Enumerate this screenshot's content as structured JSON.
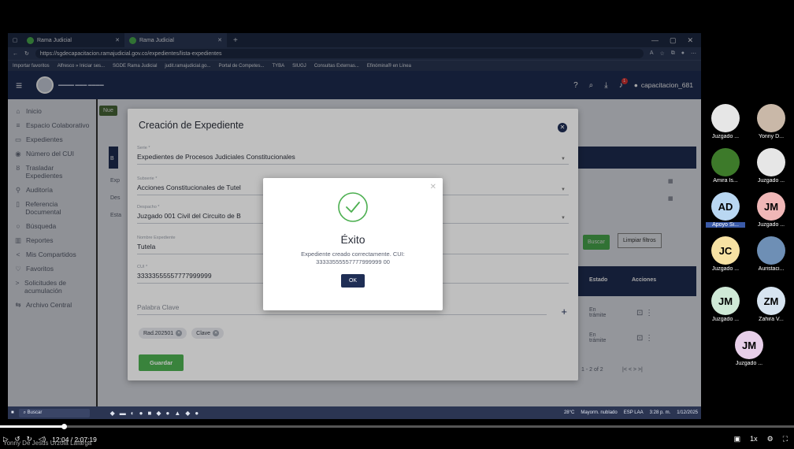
{
  "browser": {
    "tabs": [
      {
        "label": "Rama Judicial"
      },
      {
        "label": "Rama Judicial"
      }
    ],
    "url": "https://sgdecapacitacion.ramajudicial.gov.co/expedientes/lista-expedientes",
    "bookmarks": [
      "Importar favoritos",
      "Alfresco » Iniciar ses...",
      "SGDE Rama Judicial",
      "judit.ramajudicial.go...",
      "Portal de Competes...",
      "TYBA",
      "SIUGJ",
      "Consultas Externas...",
      "Efinómina® en Línea"
    ]
  },
  "app": {
    "user": "capacitacion_681",
    "notification_count": "1",
    "sidebar": [
      {
        "label": "Inicio",
        "icon": "home-icon"
      },
      {
        "label": "Espacio Colaborativo",
        "icon": "menu-icon"
      },
      {
        "label": "Expedientes",
        "icon": "folder-icon"
      },
      {
        "label": "Número del CUI",
        "icon": "hash-icon"
      },
      {
        "label": "Trasladar Expedientes",
        "icon": "transfer-icon"
      },
      {
        "label": "Auditoría",
        "icon": "audit-icon"
      },
      {
        "label": "Referencia Documental",
        "icon": "document-icon"
      },
      {
        "label": "Búsqueda",
        "icon": "search-icon"
      },
      {
        "label": "Reportes",
        "icon": "chart-icon"
      },
      {
        "label": "Mis Compartidos",
        "icon": "share-icon"
      },
      {
        "label": "Favoritos",
        "icon": "heart-icon"
      },
      {
        "label": "Solicitudes de acumulación",
        "icon": "chevron-icon"
      },
      {
        "label": "Archivo Central",
        "icon": "archive-icon"
      }
    ],
    "background": {
      "new_label": "Nue",
      "search_label": "Buscar",
      "clear_label": "Limpiar filtros",
      "col_estado": "Estado",
      "col_acciones": "Acciones",
      "row1_estado": "En trámite",
      "row2_estado": "En trámite",
      "pagination": "1 - 2 of 2",
      "exp_label": "Exp",
      "des_label": "Des",
      "est_label": "Esta",
      "b_label": "B"
    }
  },
  "modal": {
    "title": "Creación de Expediente",
    "fields": [
      {
        "label": "Serie *",
        "value": "Expedientes de Procesos Judiciales Constitucionales"
      },
      {
        "label": "Subserie *",
        "value": "Acciones Constitucionales de Tutel"
      },
      {
        "label": "Despacho *",
        "value": "Juzgado 001 Civil del Circuito de B"
      },
      {
        "label": "Nombre Expediente",
        "value": "Tutela"
      },
      {
        "label": "CUI *",
        "value": "33333555557777999999"
      },
      {
        "label": "",
        "value": "Palabra Clave"
      }
    ],
    "chips": [
      "Rad.202501",
      "Clave"
    ],
    "save_label": "Guardar"
  },
  "success": {
    "title": "Éxito",
    "message": "Expediente creado correctamente. CUI: 33333555557777999999 00",
    "ok_label": "OK",
    "accent": "#4caf50"
  },
  "taskbar": {
    "search_label": "Buscar",
    "weather": "28°C",
    "weather_sub": "Mayorm. nublado",
    "lang": "ESP LAA",
    "time": "3:28 p. m.",
    "date": "1/12/2025"
  },
  "video": {
    "time": "12:04 / 2:07:19",
    "speaker": "Yonny De Jesus Urzola Lafarga",
    "speed": "1x"
  },
  "participants": [
    {
      "initials": "",
      "name": "Juzgado ...",
      "color": "#e6e6e6",
      "highlight": false
    },
    {
      "initials": "",
      "name": "Yonny D...",
      "color": "#c9b8a8",
      "highlight": false
    },
    {
      "initials": "",
      "name": "Amira Is...",
      "color": "#3d7a2a",
      "highlight": false
    },
    {
      "initials": "",
      "name": "Juzgado ...",
      "color": "#e6e6e6",
      "highlight": false
    },
    {
      "initials": "AD",
      "name": "Apoyo Si...",
      "color": "#b9d7f2",
      "highlight": true
    },
    {
      "initials": "JM",
      "name": "Juzgado ...",
      "color": "#f0b7b7",
      "highlight": false
    },
    {
      "initials": "JC",
      "name": "Juzgado ...",
      "color": "#f7e2a3",
      "highlight": false
    },
    {
      "initials": "",
      "name": "Auristaci...",
      "color": "#6e8fb5",
      "highlight": false
    },
    {
      "initials": "JM",
      "name": "Juzgado ...",
      "color": "#cfe9d6",
      "highlight": false
    },
    {
      "initials": "ZM",
      "name": "Zahira V...",
      "color": "#d7e4f0",
      "highlight": false
    },
    {
      "initials": "JM",
      "name": "Juzgado ...",
      "color": "#e7cfe9",
      "highlight": false
    }
  ]
}
